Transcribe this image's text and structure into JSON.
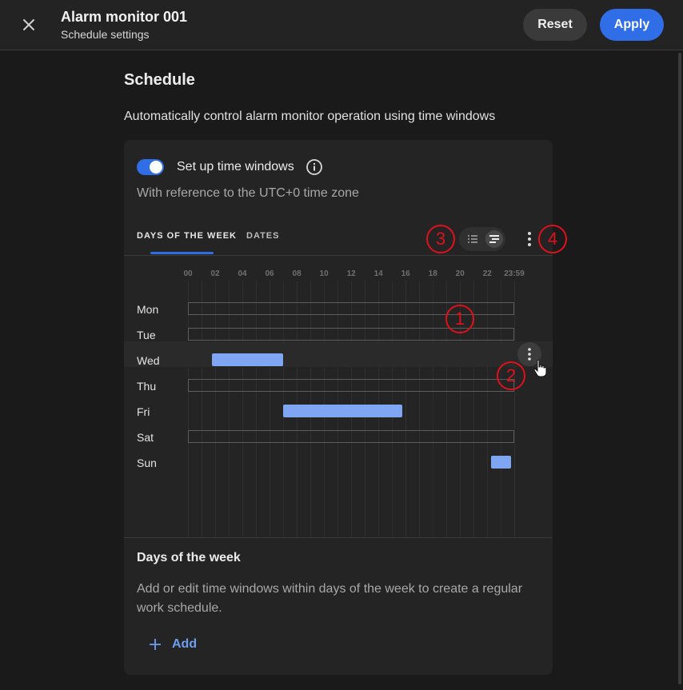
{
  "header": {
    "title": "Alarm monitor 001",
    "subtitle": "Schedule settings",
    "reset_label": "Reset",
    "apply_label": "Apply"
  },
  "section": {
    "title": "Schedule",
    "description": "Automatically control alarm monitor operation using time windows"
  },
  "toggle": {
    "label": "Set up time windows",
    "enabled": true,
    "note": "With reference to the UTC+0 time zone"
  },
  "tabs": [
    {
      "label": "DAYS OF THE WEEK",
      "active": true
    },
    {
      "label": "DATES",
      "active": false
    }
  ],
  "hours": [
    "00",
    "02",
    "04",
    "06",
    "08",
    "10",
    "12",
    "14",
    "16",
    "18",
    "20",
    "22",
    "23:59"
  ],
  "days": [
    {
      "label": "Mon",
      "windows": []
    },
    {
      "label": "Tue",
      "windows": []
    },
    {
      "label": "Wed",
      "windows": [
        {
          "start": "01:45",
          "end": "07:00"
        }
      ]
    },
    {
      "label": "Thu",
      "windows": []
    },
    {
      "label": "Fri",
      "windows": [
        {
          "start": "07:00",
          "end": "15:45"
        }
      ]
    },
    {
      "label": "Sat",
      "windows": []
    },
    {
      "label": "Sun",
      "windows": [
        {
          "start": "22:15",
          "end": "23:45"
        }
      ]
    }
  ],
  "callouts": [
    "1",
    "2",
    "3",
    "4"
  ],
  "bottom": {
    "title": "Days of the week",
    "description": "Add or edit time windows within days of the week to create a regular work schedule.",
    "add_label": "Add"
  },
  "colors": {
    "accent": "#2f6ee6",
    "window": "#7ea6f2",
    "callout": "#e0101c"
  }
}
